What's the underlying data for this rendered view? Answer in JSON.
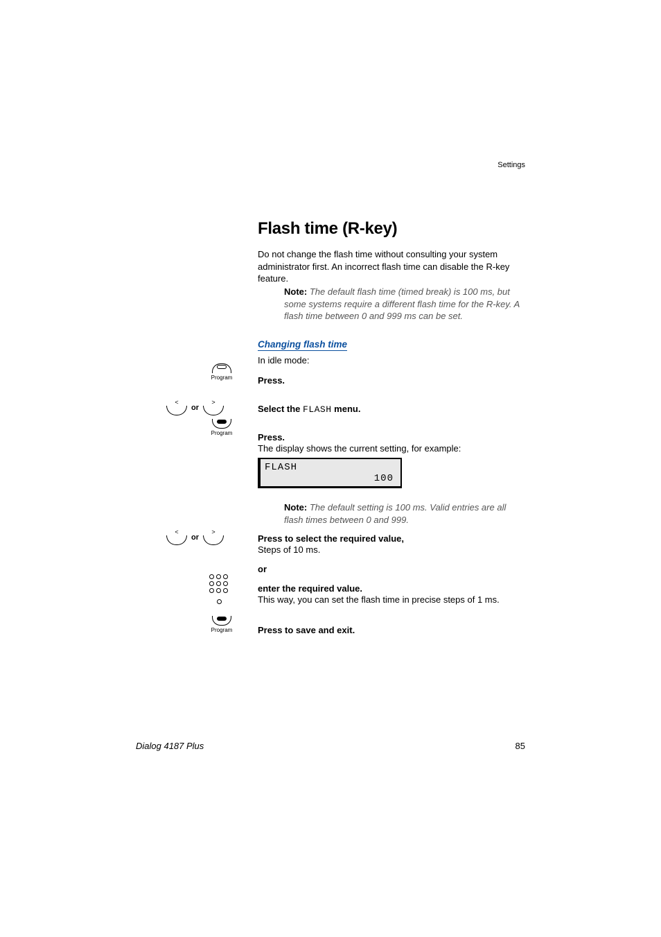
{
  "header": {
    "section": "Settings"
  },
  "title": "Flash time (R-key)",
  "intro": "Do not change the flash time without consulting your system administrator first. An incorrect flash time can disable the R-key feature.",
  "note1": {
    "label": "Note:",
    "text": "The default flash time (timed break) is 100 ms, but some systems require a different flash time for the R-key. A flash time between 0 and 999 ms can be set."
  },
  "subhead": "Changing flash time",
  "idle": "In idle mode:",
  "steps": {
    "press1": "Press.",
    "select_pre": "Select the ",
    "select_menu": "FLASH",
    "select_post": " menu.",
    "press2": "Press.",
    "press2_sub": "The display shows the current setting, for example:",
    "press3": "Press to select the required value,",
    "press3_sub": "Steps of 10 ms.",
    "or": "or",
    "enter": "enter the required value.",
    "enter_sub": "This way, you can set the flash time in precise steps of 1 ms.",
    "press4": "Press to save and exit."
  },
  "lcd": {
    "line1": "FLASH",
    "line2": "100"
  },
  "note2": {
    "label": "Note:",
    "text": "The default setting is 100 ms. Valid entries are all flash times between 0 and 999."
  },
  "icons": {
    "program": "Program",
    "or": "or"
  },
  "footer": {
    "model": "Dialog 4187 Plus",
    "page": "85"
  }
}
